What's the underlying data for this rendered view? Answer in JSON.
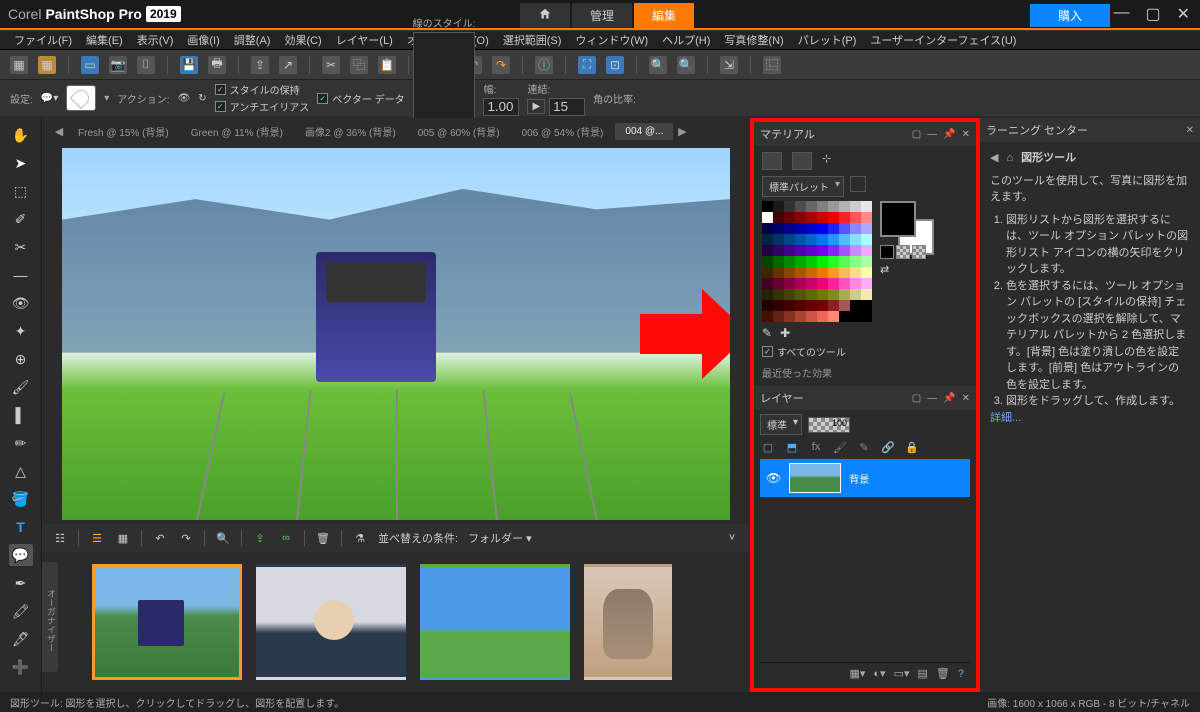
{
  "title": {
    "brand_light": "Corel",
    "brand1": "PaintShop",
    "brand2": "Pro",
    "year": "2019"
  },
  "top_tabs": {
    "manage": "管理",
    "edit": "編集",
    "buy": "購入"
  },
  "menu": [
    "ファイル(F)",
    "編集(E)",
    "表示(V)",
    "画像(I)",
    "調整(A)",
    "効果(C)",
    "レイヤー(L)",
    "オブジェクト(O)",
    "選択範囲(S)",
    "ウィンドウ(W)",
    "ヘルプ(H)",
    "写真修整(N)",
    "パレット(P)",
    "ユーザーインターフェイス(U)"
  ],
  "options": {
    "settings_label": "設定:",
    "action_label": "アクション:",
    "chk_style": "スタイルの保持",
    "chk_vector": "ベクター データ",
    "chk_anti": "アンチエイリアス",
    "line_style_label": "線のスタイル:",
    "width_label": "幅:",
    "width_value": "1.00",
    "join_label": "連結:",
    "join_value": "15",
    "corner_label": "角の比率:"
  },
  "doc_tabs": [
    {
      "label": "Fresh @  15%  (背景)"
    },
    {
      "label": "Green @  11%  (背景)"
    },
    {
      "label": "画像2 @  36%  (背景)"
    },
    {
      "label": "005 @  60%  (背景)"
    },
    {
      "label": "006 @  54%  (背景)"
    },
    {
      "label": "004 @...",
      "sel": true
    }
  ],
  "organizer": {
    "tab": "オーガナイザー",
    "sort_label": "並べ替えの条件:",
    "sort_value": "フォルダー"
  },
  "materials": {
    "title": "マテリアル",
    "palette_label": "標準パレット",
    "all_tools": "すべてのツール",
    "recent": "最近使った効果",
    "swatch_rows": [
      [
        "#000",
        "#1a1a1a",
        "#333",
        "#4d4d4d",
        "#666",
        "#808080",
        "#999",
        "#b3b3b3",
        "#ccc",
        "#e6e6e6"
      ],
      [
        "#fff",
        "#400",
        "#600",
        "#800",
        "#a00",
        "#c00",
        "#e00",
        "#f22",
        "#f55",
        "#f88"
      ],
      [
        "#004",
        "#006",
        "#008",
        "#00a",
        "#00c",
        "#00e",
        "#22f",
        "#55f",
        "#88f",
        "#aaf"
      ],
      [
        "#024",
        "#036",
        "#048",
        "#05a",
        "#06c",
        "#07e",
        "#29f",
        "#5bf",
        "#8df",
        "#aff"
      ],
      [
        "#204",
        "#306",
        "#408",
        "#50a",
        "#60c",
        "#70e",
        "#82f",
        "#a5f",
        "#c8f",
        "#eaf"
      ],
      [
        "#040",
        "#060",
        "#080",
        "#0a0",
        "#0c0",
        "#0e0",
        "#2f2",
        "#5f5",
        "#8f8",
        "#afa"
      ],
      [
        "#420",
        "#630",
        "#840",
        "#a50",
        "#c60",
        "#e70",
        "#f92",
        "#fb5",
        "#fd8",
        "#ffa"
      ],
      [
        "#402",
        "#603",
        "#804",
        "#a05",
        "#c06",
        "#e07",
        "#f29",
        "#f5b",
        "#f8d",
        "#faf"
      ],
      [
        "#220",
        "#330",
        "#440",
        "#550",
        "#660",
        "#770",
        "#882",
        "#aa5",
        "#cc8",
        "#eea"
      ],
      [
        "#200",
        "#300",
        "#400",
        "#500",
        "#600",
        "#700",
        "#822",
        "#a55",
        "#000",
        "#000"
      ],
      [
        "#410",
        "#621",
        "#832",
        "#a43",
        "#c54",
        "#e65",
        "#f87",
        "#000",
        "#000",
        "#000"
      ]
    ]
  },
  "layers": {
    "title": "レイヤー",
    "blend": "標準",
    "opacity": "100",
    "bg_name": "背景"
  },
  "learn": {
    "title": "ラーニング センター",
    "tool": "図形ツール",
    "intro": "このツールを使用して、写真に図形を加えます。",
    "steps": [
      "図形リストから図形を選択するには、ツール オプション パレットの図形リスト アイコンの横の矢印をクリックします。",
      "色を選択するには、ツール オプション パレットの [スタイルの保持] チェックボックスの選択を解除して、マテリアル パレットから 2 色選択します。[背景] 色は塗り潰しの色を設定します。[前景] 色はアウトラインの色を設定します。",
      "図形をドラッグして、作成します。"
    ],
    "details": "詳細..."
  },
  "status": {
    "left": "図形ツール: 図形を選択し、クリックしてドラッグし、図形を配置します。",
    "right": "画像:  1600 x 1066 x RGB - 8 ビット/チャネル"
  }
}
